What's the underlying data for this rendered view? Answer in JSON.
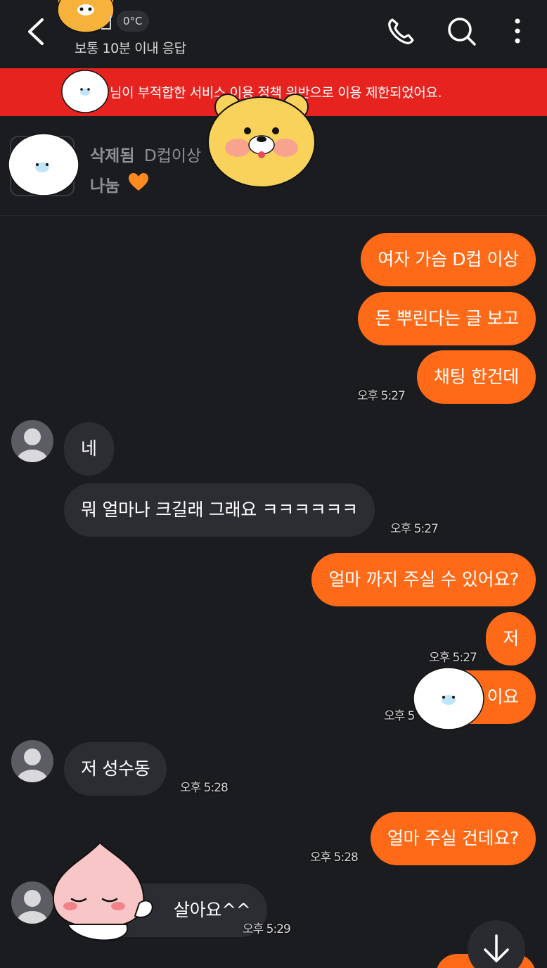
{
  "header": {
    "temperature": "0°C",
    "response_time": "보통 10분 이내 응답"
  },
  "banner": {
    "text": "님이 부적합한 서비스 이용 정책 위반으로 이용 제한되었어요."
  },
  "post": {
    "status": "삭제됨",
    "title_part1": "D컵이상",
    "title_part2": ".",
    "type": "나눔"
  },
  "messages": {
    "m1": "여자 가슴 D컵 이상",
    "m2": "돈 뿌린다는 글 보고",
    "m3": "채팅 한건데",
    "t3": "오후 5:27",
    "m4": "네",
    "m5": "뭐 얼마나 크길래 그래요 ㅋㅋㅋㅋㅋㅋ",
    "t5": "오후 5:27",
    "m6": "얼마 까지 주실 수 있어요?",
    "m7": "저",
    "t7": "오후 5:27",
    "m8": "이요",
    "t8": "오후 5",
    "m9": "저  성수동",
    "t9": "오후 5:28",
    "m10": "얼마 주실 건데요?",
    "t10": "오후 5:28",
    "m11": "살아요^^",
    "t11": "오후 5:29"
  },
  "colors": {
    "background": "#1b1c20",
    "outgoing_bubble": "#fe6a18",
    "incoming_bubble": "#2c2d32",
    "banner": "#e7231f"
  },
  "icons": [
    "back-arrow-icon",
    "phone-icon",
    "search-icon",
    "more-vertical-icon",
    "heart-icon",
    "arrow-down-icon"
  ]
}
